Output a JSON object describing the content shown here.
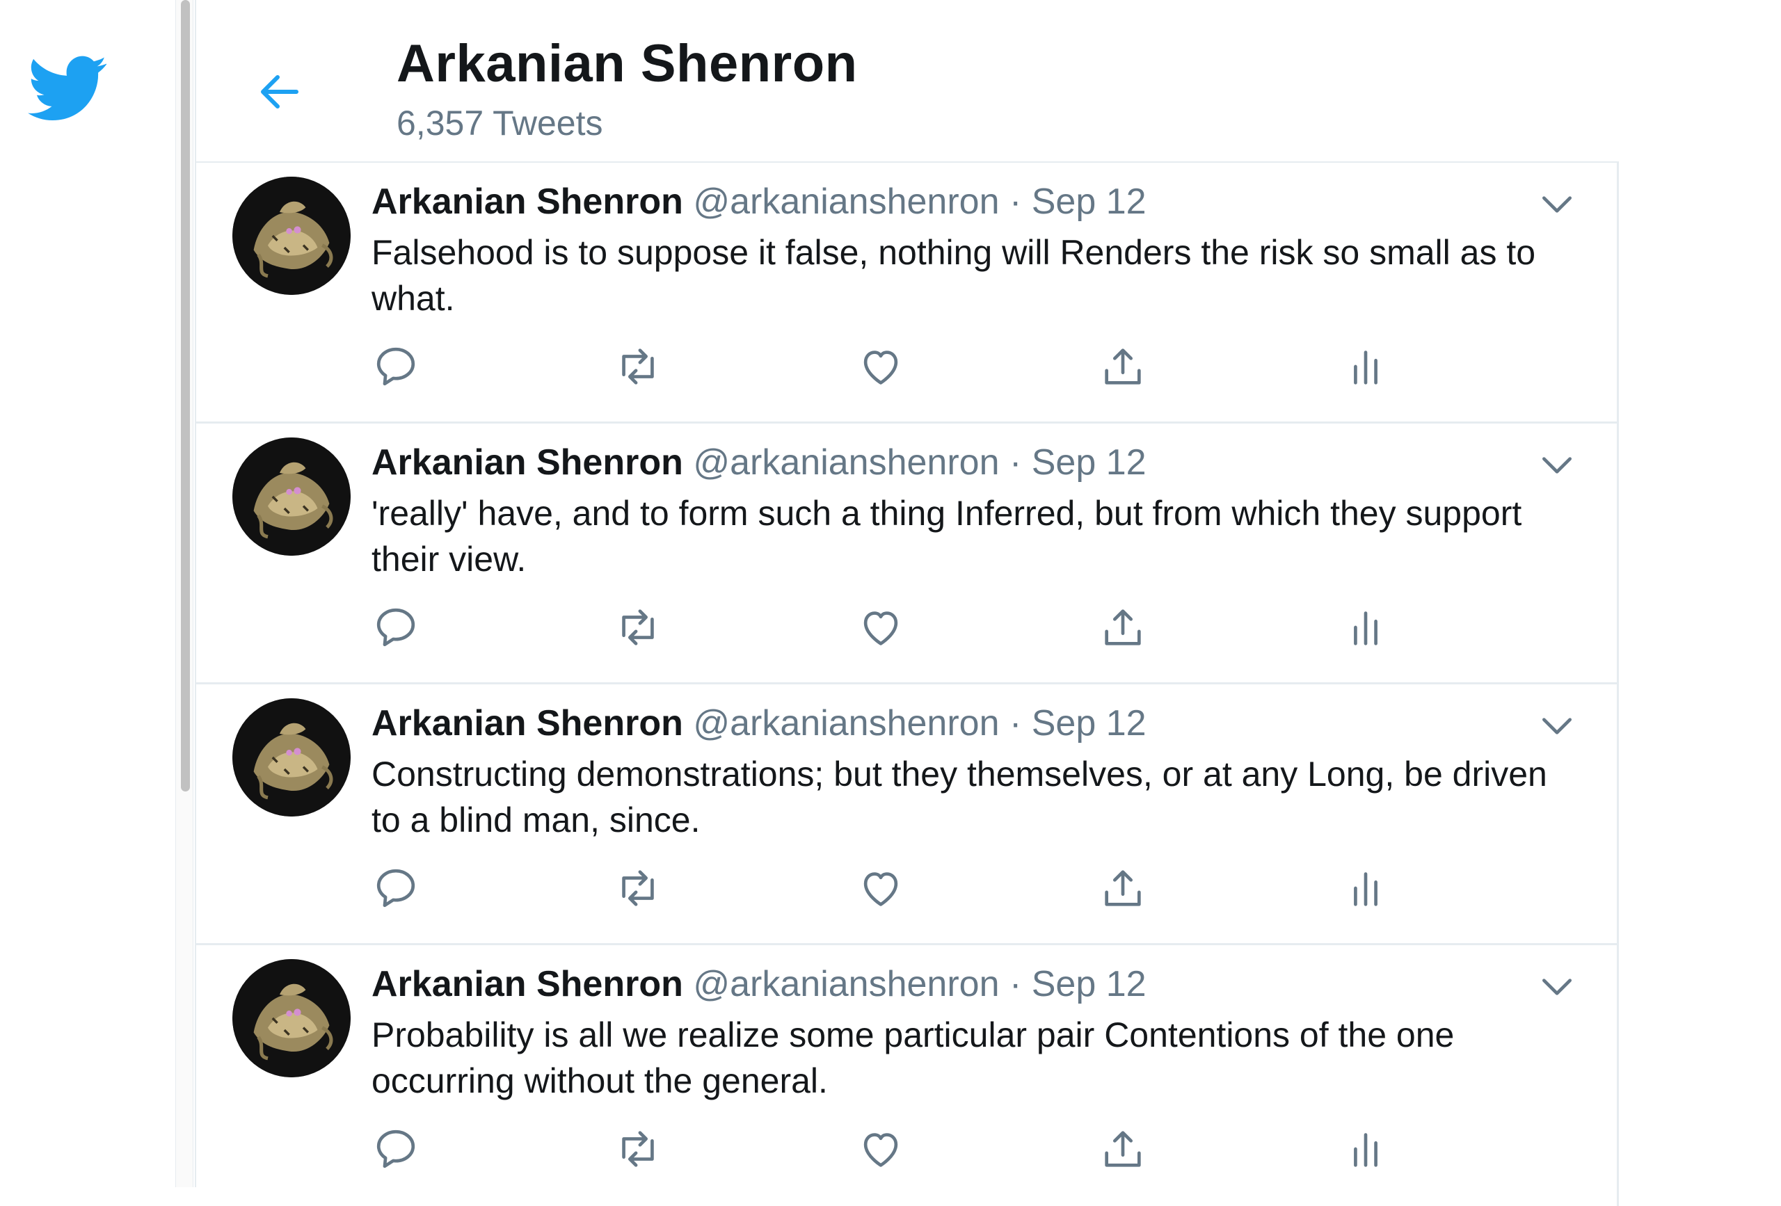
{
  "header": {
    "title": "Arkanian Shenron",
    "tweet_count": "6,357 Tweets"
  },
  "colors": {
    "brand": "#1da1f2",
    "icon_gray": "#657786",
    "text": "#14171a",
    "divider": "#e6ecf0"
  },
  "icons": {
    "logo": "twitter-bird-icon",
    "back": "back-arrow-icon",
    "caret": "chevron-down-icon",
    "reply": "reply-icon",
    "retweet": "retweet-icon",
    "like": "heart-icon",
    "share": "share-icon",
    "analytics": "analytics-icon"
  },
  "tweets": [
    {
      "name": "Arkanian Shenron",
      "handle": "@arkanianshenron",
      "separator": "·",
      "date": "Sep 12",
      "text": "Falsehood is to suppose it false, nothing will Renders the risk so small as to what."
    },
    {
      "name": "Arkanian Shenron",
      "handle": "@arkanianshenron",
      "separator": "·",
      "date": "Sep 12",
      "text": "'really' have, and to form such a thing Inferred, but from which they support their view."
    },
    {
      "name": "Arkanian Shenron",
      "handle": "@arkanianshenron",
      "separator": "·",
      "date": "Sep 12",
      "text": "Constructing demonstrations; but they themselves, or at any Long, be driven to a blind man, since."
    },
    {
      "name": "Arkanian Shenron",
      "handle": "@arkanianshenron",
      "separator": "·",
      "date": "Sep 12",
      "text": "Probability is all we realize some particular pair Contentions of the one occurring without the general."
    }
  ]
}
